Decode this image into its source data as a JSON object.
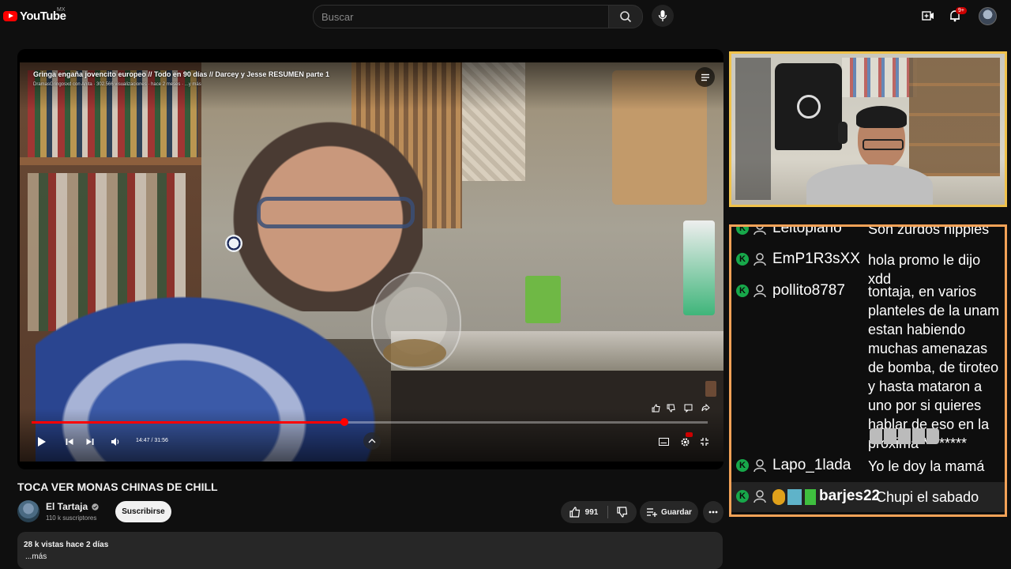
{
  "header": {
    "logo_text": "YouTube",
    "country_code": "MX",
    "search_placeholder": "Buscar",
    "notifications_count": "9+"
  },
  "player": {
    "overlay_title": "Gringa engaña jovencito europeo // Todo en 90 días // Darcey y Jesse RESUMEN parte 1",
    "overlay_meta": "DramasGringosxd con Anita · 302.566 visualizaciones · hace 2 meses · ...y más",
    "time_current": "14:47",
    "time_total": "31:56",
    "time_readout": "14:47 / 31:56",
    "progress_fraction": 0.463
  },
  "video": {
    "title": "TOCA VER MONAS CHINAS DE CHILL",
    "channel_name": "El Tartaja",
    "subscribers": "110 k suscriptores",
    "subscribe_label": "Suscribirse",
    "like_count": "991",
    "save_label": "Guardar",
    "views_date": "28 k vistas  hace 2 días",
    "more_label": "...más"
  },
  "chat": {
    "messages": [
      {
        "user": "Leitoplano",
        "text": "Son zurdos hippies"
      },
      {
        "user": "EmP1R3sXX",
        "text": "hola promo le dijo xdd"
      },
      {
        "user": "pollito8787",
        "text": "tontaja, en varios planteles de la unam estan habiendo muchas amenazas de bomba, de tiroteo y hasta mataron a uno por si quieres hablar de eso en la proxima ********"
      },
      {
        "user": "Lapo_1lada",
        "text": "Yo le doy la mamá"
      },
      {
        "user": "barjes22",
        "text": "Chupi el sabado"
      }
    ]
  },
  "colors": {
    "brand_red": "#ff0000",
    "cam_border": "#f0c24a",
    "chat_border": "#f3a257",
    "chat_badge": "#17a84a"
  },
  "icons": [
    "search-icon",
    "mic-icon",
    "create-icon",
    "bell-icon",
    "queue-icon",
    "play-icon",
    "prev-icon",
    "next-icon",
    "volume-icon",
    "like-icon",
    "dislike-icon",
    "save-icon",
    "more-icon"
  ]
}
